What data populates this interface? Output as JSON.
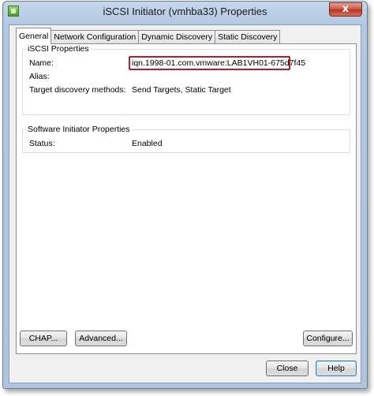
{
  "window": {
    "title": "iSCSI Initiator (vmhba33) Properties",
    "close_glyph": "x"
  },
  "tabs": [
    {
      "label": "General",
      "active": true
    },
    {
      "label": "Network Configuration",
      "active": false
    },
    {
      "label": "Dynamic Discovery",
      "active": false
    },
    {
      "label": "Static Discovery",
      "active": false
    }
  ],
  "iscsi_properties": {
    "title": "iSCSI Properties",
    "name_label": "Name:",
    "name_value": "iqn.1998-01.com.vmware:LAB1VH01-675d7f45",
    "alias_label": "Alias:",
    "alias_value": "",
    "discovery_label": "Target discovery methods:",
    "discovery_value": "Send Targets, Static Target"
  },
  "software_initiator": {
    "title": "Software Initiator Properties",
    "status_label": "Status:",
    "status_value": "Enabled"
  },
  "buttons": {
    "chap": "CHAP...",
    "advanced": "Advanced...",
    "configure": "Configure...",
    "close": "Close",
    "help": "Help"
  },
  "colors": {
    "highlight_box": "#b0202a",
    "window_frame": "#aec4df"
  }
}
